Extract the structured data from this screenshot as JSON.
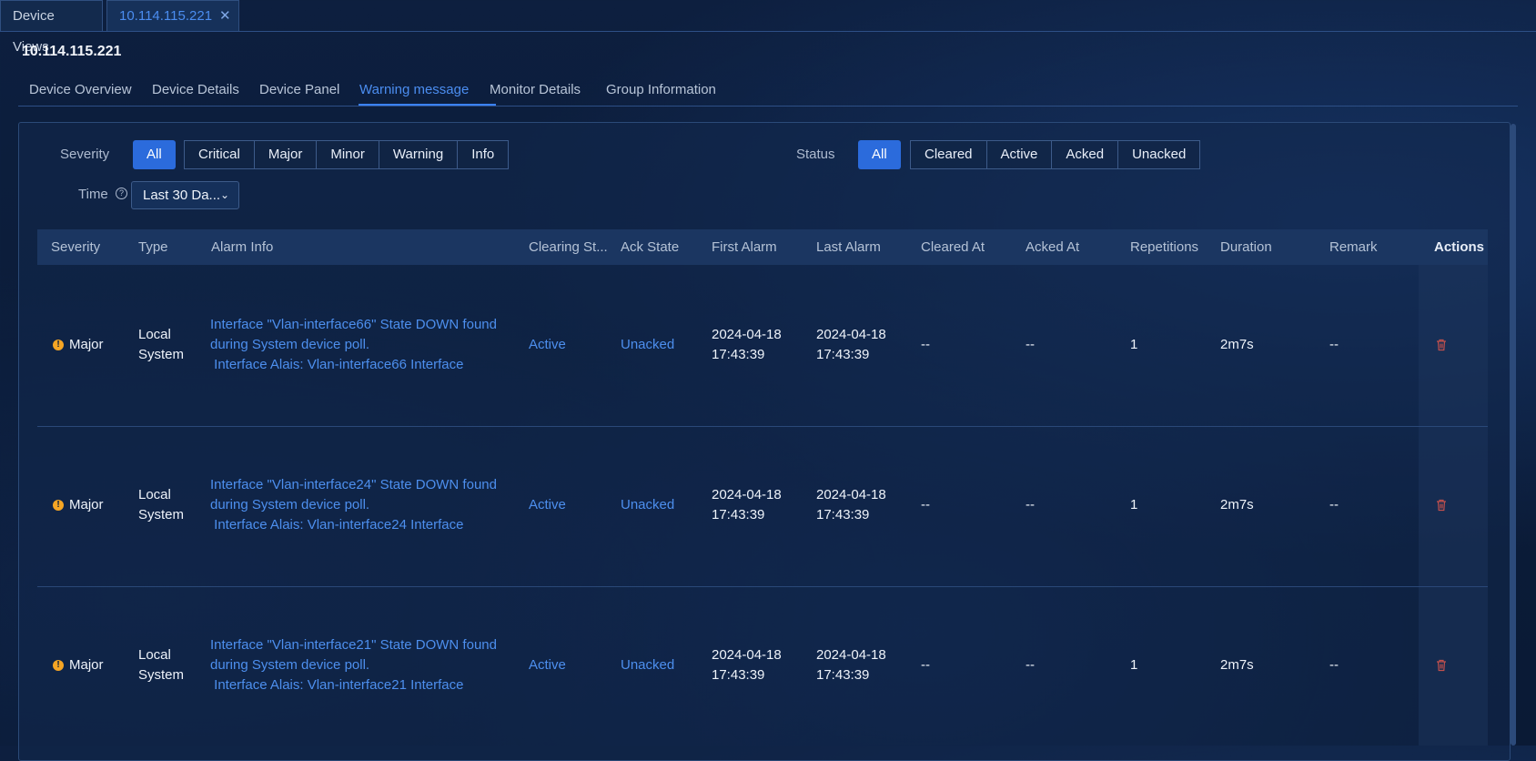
{
  "tabs": [
    {
      "label": "Device Views"
    },
    {
      "label": "10.114.115.221",
      "close_icon": "close-icon"
    }
  ],
  "device_title": "10.114.115.221",
  "subtabs": [
    "Device Overview",
    "Device Details",
    "Device Panel",
    "Warning message",
    "Monitor Details",
    "Group Information"
  ],
  "active_subtab": "Warning message",
  "filters": {
    "severity_label": "Severity",
    "severity_all": "All",
    "severity_options": [
      "Critical",
      "Major",
      "Minor",
      "Warning",
      "Info"
    ],
    "status_label": "Status",
    "status_all": "All",
    "status_options": [
      "Cleared",
      "Active",
      "Acked",
      "Unacked"
    ],
    "time_label": "Time",
    "time_help_icon": "question-circle-icon",
    "time_value": "Last 30 Da...",
    "time_chevron_icon": "chevron-down-icon"
  },
  "columns": [
    "Severity",
    "Type",
    "Alarm Info",
    "Clearing St...",
    "Ack State",
    "First Alarm",
    "Last Alarm",
    "Cleared At",
    "Acked At",
    "Repetitions",
    "Duration",
    "Remark",
    "Actions"
  ],
  "rows": [
    {
      "severity": "Major",
      "type_line1": "Local",
      "type_line2": "System",
      "info_line1": "Interface \"Vlan-interface66\" State DOWN found",
      "info_line2": "during System device poll.",
      "info_line3": " Interface Alais: Vlan-interface66 Interface",
      "clearing": "Active",
      "ack": "Unacked",
      "first_date": "2024-04-18",
      "first_time": "17:43:39",
      "last_date": "2024-04-18",
      "last_time": "17:43:39",
      "cleared_at": "--",
      "acked_at": "--",
      "repetitions": "1",
      "duration": "2m7s",
      "remark": "--"
    },
    {
      "severity": "Major",
      "type_line1": "Local",
      "type_line2": "System",
      "info_line1": "Interface \"Vlan-interface24\" State DOWN found",
      "info_line2": "during System device poll.",
      "info_line3": " Interface Alais: Vlan-interface24 Interface",
      "clearing": "Active",
      "ack": "Unacked",
      "first_date": "2024-04-18",
      "first_time": "17:43:39",
      "last_date": "2024-04-18",
      "last_time": "17:43:39",
      "cleared_at": "--",
      "acked_at": "--",
      "repetitions": "1",
      "duration": "2m7s",
      "remark": "--"
    },
    {
      "severity": "Major",
      "type_line1": "Local",
      "type_line2": "System",
      "info_line1": "Interface \"Vlan-interface21\" State DOWN found",
      "info_line2": "during System device poll.",
      "info_line3": " Interface Alais: Vlan-interface21 Interface",
      "clearing": "Active",
      "ack": "Unacked",
      "first_date": "2024-04-18",
      "first_time": "17:43:39",
      "last_date": "2024-04-18",
      "last_time": "17:43:39",
      "cleared_at": "--",
      "acked_at": "--",
      "repetitions": "1",
      "duration": "2m7s",
      "remark": "--"
    }
  ],
  "colors": {
    "accent": "#2b6bdc",
    "link": "#4d8fee",
    "major": "#f5a524",
    "delete": "#c0504d"
  }
}
